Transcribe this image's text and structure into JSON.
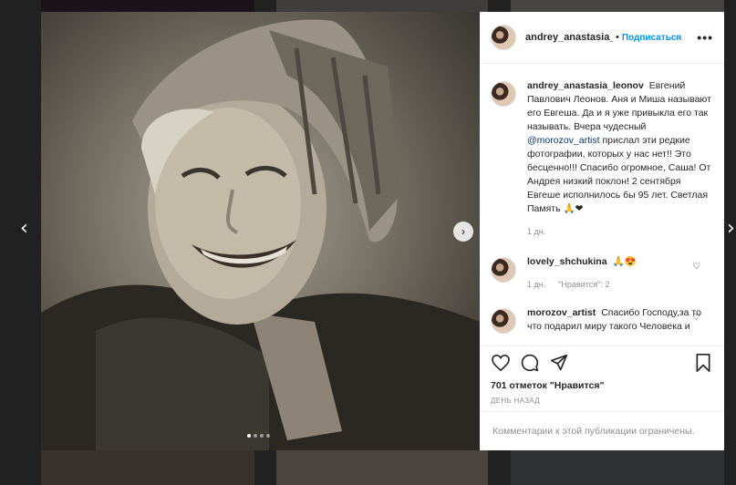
{
  "post": {
    "username": "andrey_anastasia_leonov",
    "username_truncated": "andrey_anastasia_lс",
    "follow_label": "Подписаться",
    "more_label": "•••",
    "caption": "Евгений Павлович Леонов. Аня и Миша называют его Евгеша. Да и я уже привыкла его так называть. Вчера чудесный",
    "caption_mention": "@morozov_artist",
    "caption_rest": "прислал эти редкие фотографии, которых у нас нет!! Это бесценно!!! Спасибо огромное, Саша! От Андрея низкий поклон! 2 сентября Евгеше исполнилось бы 95 лет. Светлая Память",
    "caption_emoji": "🙏❤",
    "caption_time": "1 дн.",
    "likes": "701 отметок \"Нравится\"",
    "date": "ДЕНЬ НАЗАД",
    "comments_disabled": "Комментарии к этой публикации ограничены."
  },
  "comments": [
    {
      "user": "lovely_shchukina",
      "text": "🙏😍",
      "time": "1 дн.",
      "likes": "\"Нравится\": 2"
    },
    {
      "user": "morozov_artist",
      "text": "Спасибо Господу,за то что подарил миру такого Человека и",
      "time": "",
      "likes": ""
    }
  ],
  "carousel": {
    "slides": 4,
    "current": 1
  },
  "icons": [
    "heart-icon",
    "comment-icon",
    "share-icon",
    "bookmark-icon",
    "chevron-right-icon",
    "chevron-left-icon",
    "close-icon"
  ],
  "colors": {
    "link": "#0095f6",
    "muted": "#8e8e8e",
    "text": "#262626"
  }
}
